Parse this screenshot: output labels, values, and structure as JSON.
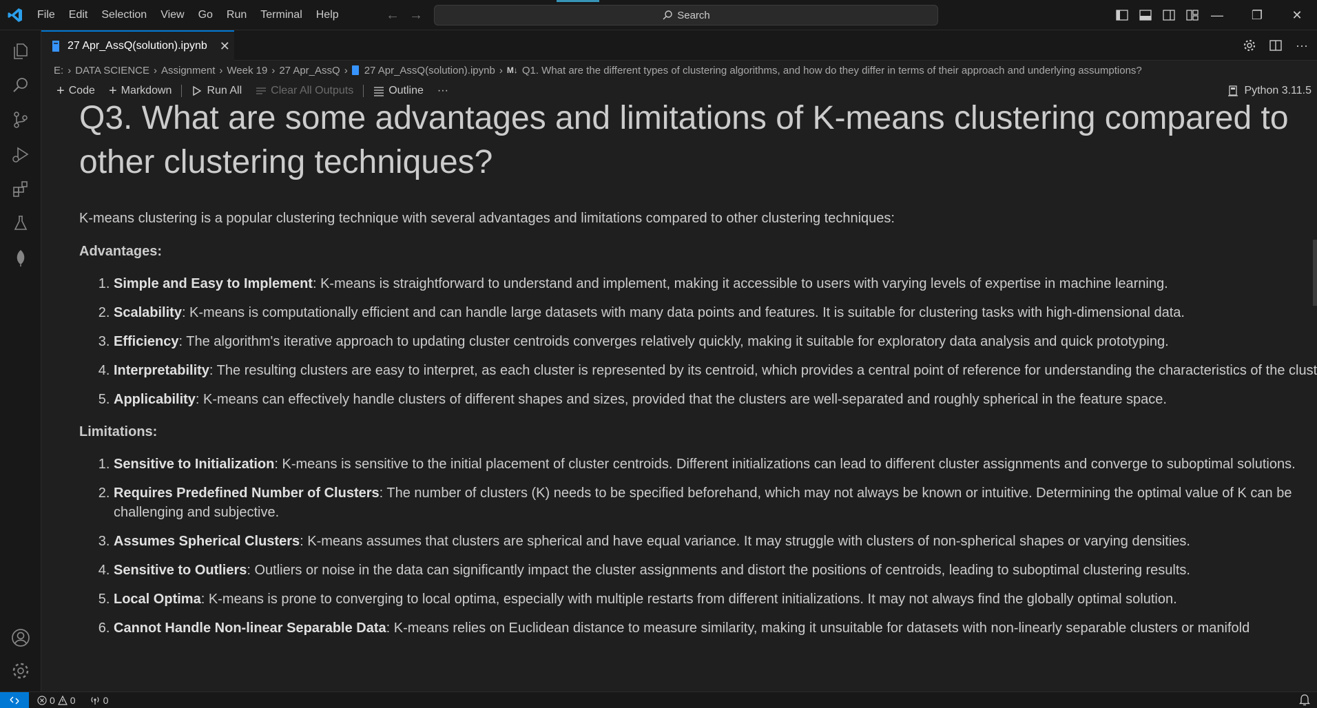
{
  "colors": {
    "accent": "#0078d4",
    "kernel_icon": "#3794ff",
    "background": "#1f1f1f",
    "chrome": "#181818"
  },
  "menubar": [
    "File",
    "Edit",
    "Selection",
    "View",
    "Go",
    "Run",
    "Terminal",
    "Help"
  ],
  "search": {
    "label": "Search"
  },
  "tab": {
    "title": "27 Apr_AssQ(solution).ipynb",
    "close": "✕"
  },
  "breadcrumb": {
    "parts": [
      "E:",
      "DATA SCIENCE",
      "Assignment",
      "Week 19",
      "27 Apr_AssQ",
      "27 Apr_AssQ(solution).ipynb"
    ],
    "md_badge": "M↓",
    "heading": "Q1. What are the different types of clustering algorithms, and how do they differ in terms of their approach and underlying assumptions?"
  },
  "toolbar": {
    "code": "Code",
    "markdown": "Markdown",
    "run_all": "Run All",
    "clear_outputs": "Clear All Outputs",
    "outline": "Outline",
    "more": "···",
    "kernel": "Python 3.11.5"
  },
  "content": {
    "heading": "Q3. What are some advantages and limitations of K-means clustering compared to other clustering techniques?",
    "intro": "K-means clustering is a popular clustering technique with several advantages and limitations compared to other clustering techniques:",
    "advantages_title": "Advantages:",
    "advantages": [
      {
        "term": "Simple and Easy to Implement",
        "text": ": K-means is straightforward to understand and implement, making it accessible to users with varying levels of expertise in machine learning."
      },
      {
        "term": "Scalability",
        "text": ": K-means is computationally efficient and can handle large datasets with many data points and features. It is suitable for clustering tasks with high-dimensional data."
      },
      {
        "term": "Efficiency",
        "text": ": The algorithm's iterative approach to updating cluster centroids converges relatively quickly, making it suitable for exploratory data analysis and quick prototyping."
      },
      {
        "term": "Interpretability",
        "text": ": The resulting clusters are easy to interpret, as each cluster is represented by its centroid, which provides a central point of reference for understanding the characteristics of the cluster."
      },
      {
        "term": "Applicability",
        "text": ": K-means can effectively handle clusters of different shapes and sizes, provided that the clusters are well-separated and roughly spherical in the feature space."
      }
    ],
    "limitations_title": "Limitations:",
    "limitations": [
      {
        "term": "Sensitive to Initialization",
        "text": ": K-means is sensitive to the initial placement of cluster centroids. Different initializations can lead to different cluster assignments and converge to suboptimal solutions."
      },
      {
        "term": "Requires Predefined Number of Clusters",
        "text": ": The number of clusters (K) needs to be specified beforehand, which may not always be known or intuitive. Determining the optimal value of K can be challenging and subjective."
      },
      {
        "term": "Assumes Spherical Clusters",
        "text": ": K-means assumes that clusters are spherical and have equal variance. It may struggle with clusters of non-spherical shapes or varying densities."
      },
      {
        "term": "Sensitive to Outliers",
        "text": ": Outliers or noise in the data can significantly impact the cluster assignments and distort the positions of centroids, leading to suboptimal clustering results."
      },
      {
        "term": "Local Optima",
        "text": ": K-means is prone to converging to local optima, especially with multiple restarts from different initializations. It may not always find the globally optimal solution."
      },
      {
        "term": "Cannot Handle Non-linear Separable Data",
        "text": ": K-means relies on Euclidean distance to measure similarity, making it unsuitable for datasets with non-linearly separable clusters or manifold"
      }
    ]
  },
  "statusbar": {
    "errors": "0",
    "warnings": "0",
    "ports": "0"
  },
  "icons": {
    "activity": [
      "explorer-icon",
      "search-icon",
      "source-control-icon",
      "run-debug-icon",
      "extensions-icon",
      "testing-icon",
      "leaf-icon",
      "account-icon",
      "manage-gear-icon"
    ]
  }
}
